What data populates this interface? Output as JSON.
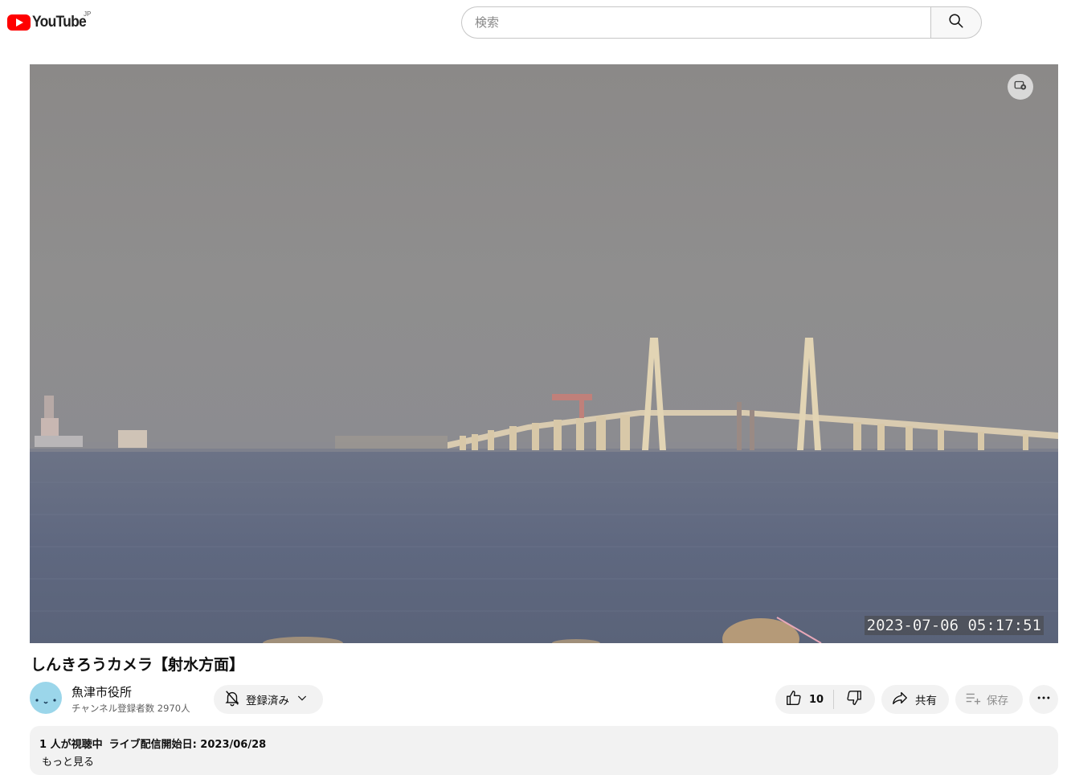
{
  "header": {
    "logo_text": "YouTube",
    "region": "JP",
    "search_placeholder": "検索"
  },
  "player": {
    "timestamp": "2023-07-06 05:17:51"
  },
  "video": {
    "title": "しんきろうカメラ【射水方面】"
  },
  "channel": {
    "name": "魚津市役所",
    "subscribers": "チャンネル登録者数 2970人",
    "subscribe_label": "登録済み"
  },
  "actions": {
    "like_count": "10",
    "share_label": "共有",
    "save_label": "保存"
  },
  "description": {
    "viewers": "1 人が視聴中",
    "started": "ライブ配信開始日: 2023/06/28",
    "more_label": "もっと見る"
  },
  "colors": {
    "brand_red": "#ff0000",
    "chip_bg": "#f2f2f2"
  }
}
